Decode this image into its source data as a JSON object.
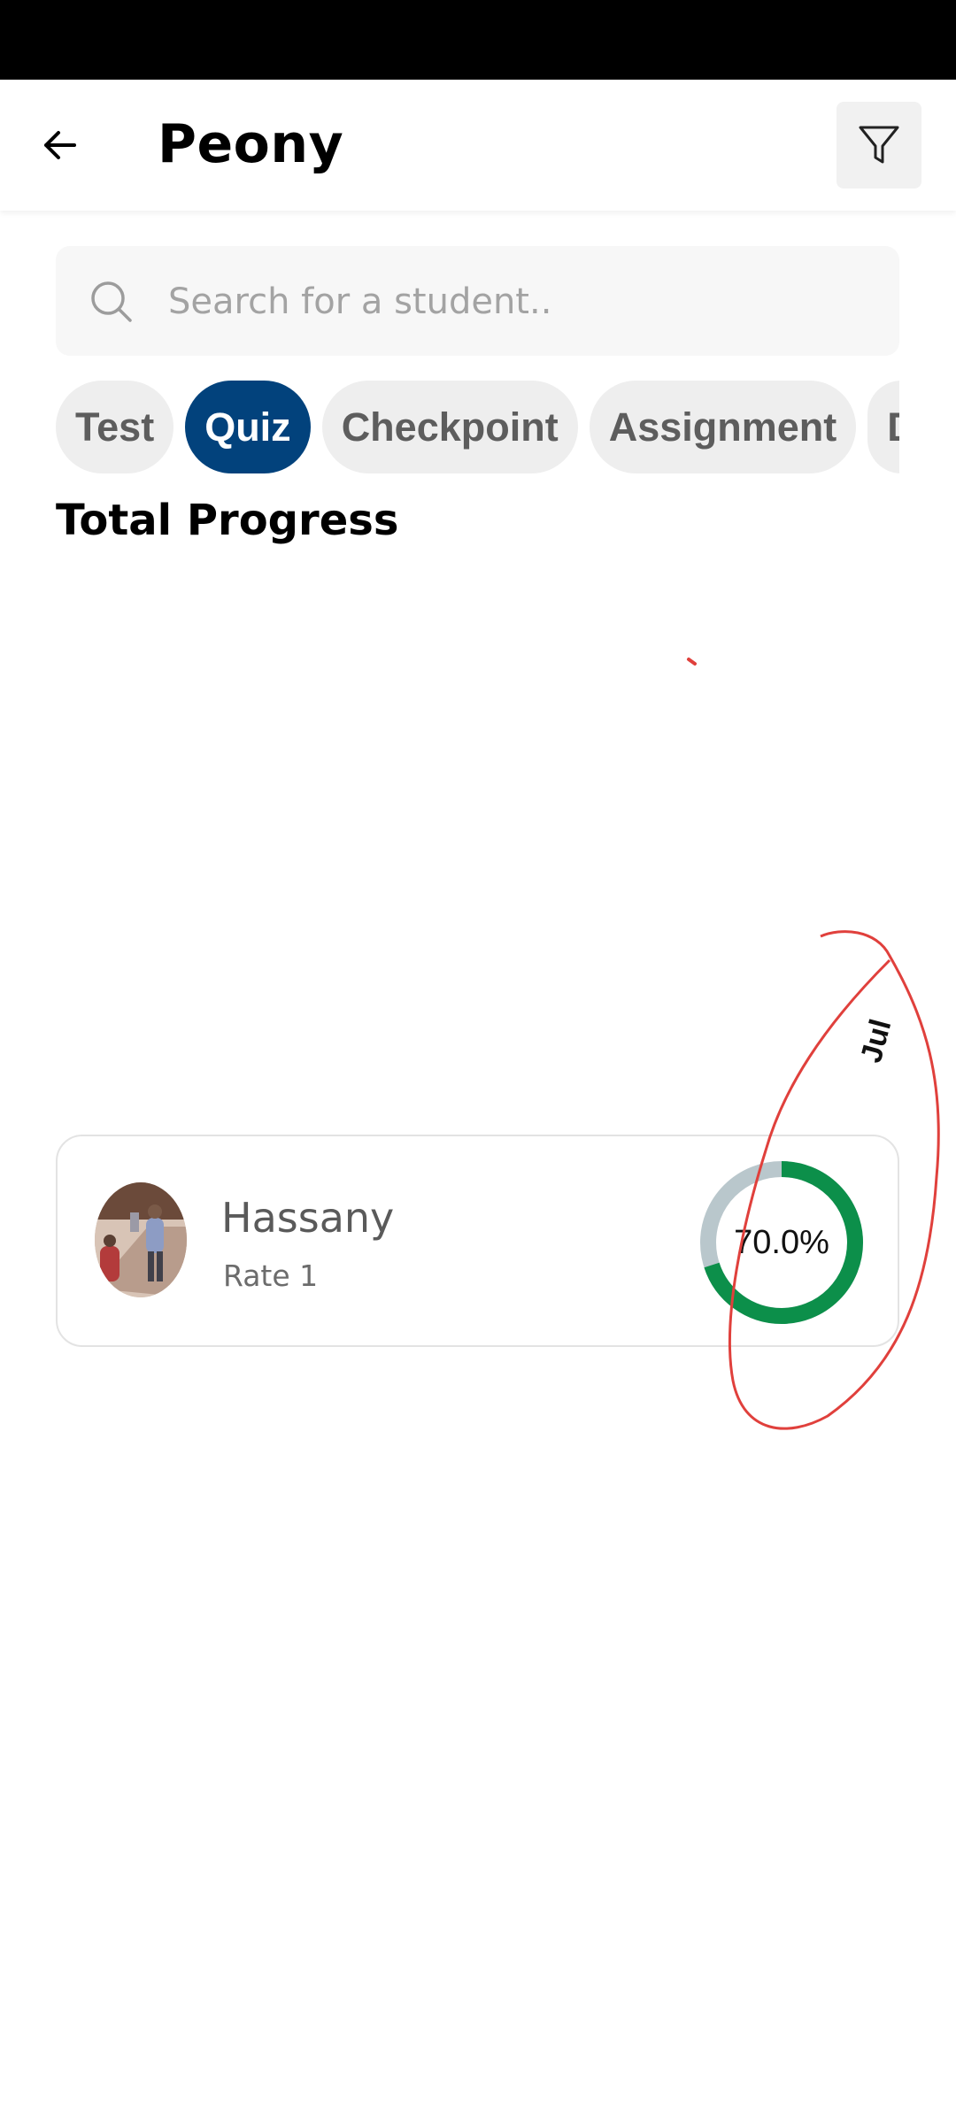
{
  "header": {
    "title": "Peony",
    "back_icon": "arrow-left-icon",
    "filter_icon": "filter-funnel-icon"
  },
  "search": {
    "placeholder": "Search for a student..",
    "value": ""
  },
  "tabs": [
    {
      "label": "Test",
      "active": false
    },
    {
      "label": "Quiz",
      "active": true
    },
    {
      "label": "Checkpoint",
      "active": false
    },
    {
      "label": "Assignment",
      "active": false
    },
    {
      "label": "D",
      "active": false
    }
  ],
  "section": {
    "title": "Total Progress"
  },
  "chart": {
    "axis_label": "Jul"
  },
  "students": [
    {
      "name": "Hassany",
      "rate": "Rate 1",
      "progress_text": "70.0%",
      "progress": 0.7
    }
  ],
  "colors": {
    "accent": "#02427c",
    "progress": "#0c8f4a",
    "progress_track": "#b9c7cc",
    "annotation": "#e0403c"
  }
}
